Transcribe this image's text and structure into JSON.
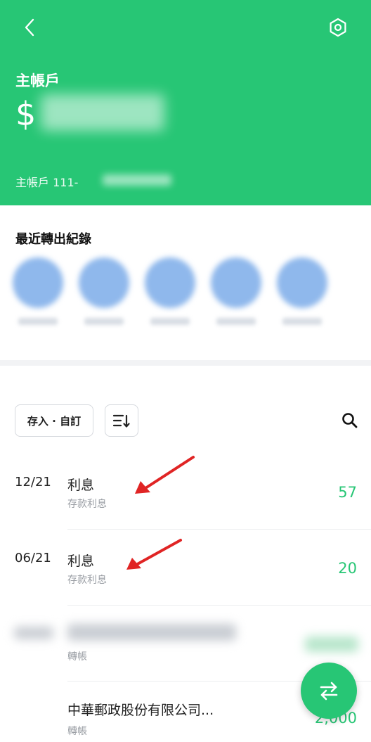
{
  "header": {
    "account_title": "主帳戶",
    "currency_symbol": "$",
    "account_number_prefix": "主帳戶 111-"
  },
  "recent": {
    "title": "最近轉出紀錄"
  },
  "toolbar": {
    "filter_label": "存入 · 自訂"
  },
  "transactions": [
    {
      "date": "12/21",
      "name": "利息",
      "sub": "存款利息",
      "amount": "57"
    },
    {
      "date": "06/21",
      "name": "利息",
      "sub": "存款利息",
      "amount": "20"
    },
    {
      "date": "",
      "name": "",
      "sub": "轉帳",
      "amount": ""
    },
    {
      "date": "",
      "name": "中華郵政股份有限公司...",
      "sub": "轉帳",
      "amount": "2,000"
    }
  ],
  "colors": {
    "brand": "#27c675",
    "annotation_arrow": "#e02424"
  }
}
